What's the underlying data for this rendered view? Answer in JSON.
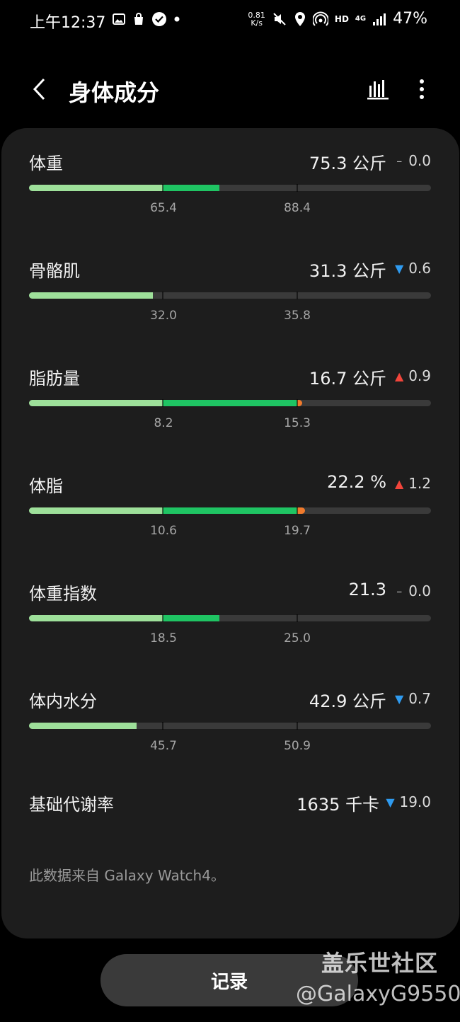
{
  "status_bar": {
    "time": "上午12:37",
    "net_speed_value": "0.81",
    "net_speed_unit": "K/s",
    "hd": "HD",
    "network": "4G",
    "battery": "47%"
  },
  "header": {
    "title": "身体成分"
  },
  "metrics": [
    {
      "label": "体重",
      "value": "75.3 公斤",
      "delta_dir": "flat",
      "delta_symbol": "–",
      "delta": "0.0",
      "ticks": [
        "65.4",
        "88.4"
      ],
      "fill_light": 0.333,
      "fill_green": 0.474,
      "fill_orange": 0
    },
    {
      "label": "骨骼肌",
      "value": "31.3 公斤",
      "delta_dir": "down",
      "delta_symbol": "▼",
      "delta": "0.6",
      "ticks": [
        "32.0",
        "35.8"
      ],
      "fill_light": 0.308,
      "fill_green": 0.308,
      "fill_orange": 0
    },
    {
      "label": "脂肪量",
      "value": "16.7 公斤",
      "delta_dir": "up",
      "delta_symbol": "▲",
      "delta": "0.9",
      "ticks": [
        "8.2",
        "15.3"
      ],
      "fill_light": 0.333,
      "fill_green": 0.667,
      "fill_orange": 0.68
    },
    {
      "label": "体脂",
      "value": "22.2 %",
      "delta_dir": "up",
      "delta_symbol": "▲",
      "delta": "1.2",
      "ticks": [
        "10.6",
        "19.7"
      ],
      "fill_light": 0.333,
      "fill_green": 0.667,
      "fill_orange": 0.687
    },
    {
      "label": "体重指数",
      "value": "21.3",
      "delta_dir": "flat",
      "delta_symbol": "–",
      "delta": "0.0",
      "ticks": [
        "18.5",
        "25.0"
      ],
      "fill_light": 0.333,
      "fill_green": 0.474,
      "fill_orange": 0
    },
    {
      "label": "体内水分",
      "value": "42.9 公斤",
      "delta_dir": "down",
      "delta_symbol": "▼",
      "delta": "0.7",
      "ticks": [
        "45.7",
        "50.9"
      ],
      "fill_light": 0.268,
      "fill_green": 0.268,
      "fill_orange": 0
    }
  ],
  "bmr": {
    "label": "基础代谢率",
    "value": "1635 千卡",
    "delta_dir": "down",
    "delta_symbol": "▼",
    "delta": "19.0"
  },
  "source_note": "此数据来自 Galaxy Watch4。",
  "record_button": "记录",
  "watermark": {
    "title": "盖乐世社区",
    "handle": "@GalaxyG9550"
  },
  "colors": {
    "background": "#000000",
    "card": "#1d1d1d",
    "bar_track": "#3a3a3a",
    "bar_light": "#9ee09a",
    "bar_green": "#1fc463",
    "bar_orange": "#f07a2c",
    "delta_down": "#2f9bf0",
    "delta_up": "#f2453b"
  }
}
